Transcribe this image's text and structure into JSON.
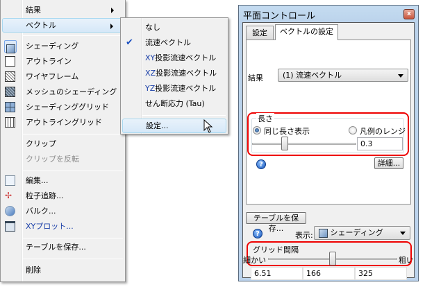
{
  "context_menu": {
    "items": [
      {
        "label": "結果",
        "icon": "",
        "submenu": true
      },
      {
        "label": "ベクトル",
        "icon": "",
        "submenu": true,
        "highlighted": true
      },
      {
        "label": "シェーディング",
        "icon": "shaded-cube-icon",
        "selected": true
      },
      {
        "label": "アウトライン",
        "icon": "outline-cube-icon"
      },
      {
        "label": "ワイヤフレーム",
        "icon": "wireframe-cube-icon"
      },
      {
        "label": "メッシュのシェーディング",
        "icon": "mesh-shading-cube-icon"
      },
      {
        "label": "シェーディンググリッド",
        "icon": "shading-grid-icon"
      },
      {
        "label": "アウトライングリッド",
        "icon": "outline-grid-icon"
      },
      {
        "label": "クリップ"
      },
      {
        "label": "クリップを反転",
        "disabled": true
      },
      {
        "label": "編集...",
        "icon": "edit-icon"
      },
      {
        "label": "粒子追跡...",
        "icon": "particle-trace-icon"
      },
      {
        "label": "バルク...",
        "icon": "bulk-icon"
      },
      {
        "label": "XYプロット...",
        "icon": "xy-plot-icon"
      },
      {
        "label": "テーブルを保存..."
      },
      {
        "label": "削除"
      }
    ]
  },
  "vector_submenu": {
    "items": [
      {
        "label": "なし"
      },
      {
        "label": "流速ベクトル",
        "checked": true
      },
      {
        "prefix": "XY",
        "label": "投影流速ベクトル"
      },
      {
        "prefix": "XZ",
        "label": "投影流速ベクトル"
      },
      {
        "prefix": "YZ",
        "label": "投影流速ベクトル"
      },
      {
        "label": "せん断応力 (Tau)"
      },
      {
        "label": "設定...",
        "highlighted": true
      }
    ]
  },
  "panel": {
    "title": "平面コントロール",
    "close": "x",
    "tabs": [
      "設定",
      "ベクトルの設定"
    ],
    "result_label": "結果",
    "result_value": "(1) 流速ベクトル",
    "length_group": "長さ",
    "radio_same": "同じ長さ表示",
    "radio_legend": "凡例のレンジ",
    "length_value": "0.3",
    "length_slider_fraction": 0.3,
    "details_button": "詳細...",
    "help": "?",
    "save_table": "テーブルを保存...",
    "display_label": "表示:",
    "display_value": "シェーディング",
    "grid_group": "グリッド間隔",
    "fine": "細かい",
    "coarse": "粗い",
    "grid_slider_fraction": 0.5,
    "grid_values": [
      "6.51",
      "166",
      "325"
    ]
  },
  "colors": {
    "highlight_red": "#ee0000",
    "accent_blue": "#1a3fa8"
  }
}
